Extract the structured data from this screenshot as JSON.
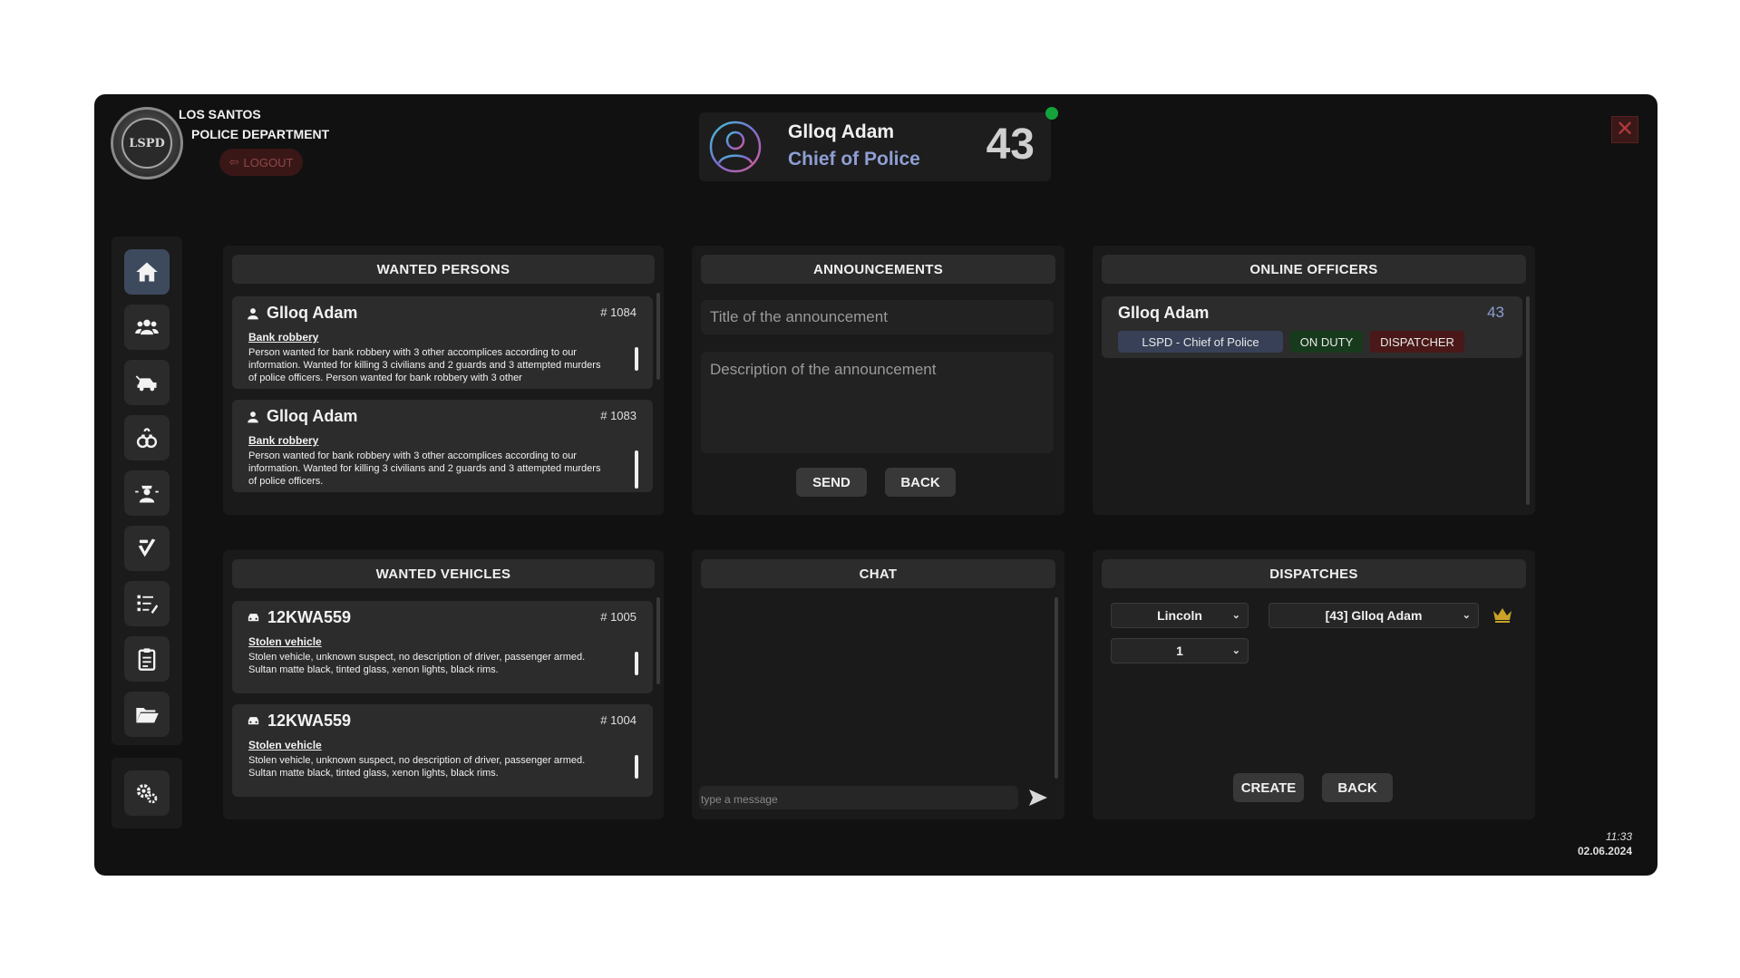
{
  "header": {
    "badge_text": "LSPD",
    "dept_line1": "LOS SANTOS",
    "dept_line2": "POLICE DEPARTMENT",
    "logout_label": "LOGOUT",
    "officer_name": "Glloq Adam",
    "officer_rank": "Chief of Police",
    "badge_number": "43",
    "close_label": "✕"
  },
  "sidebar": {
    "items": [
      {
        "icon": "home-icon",
        "active": true
      },
      {
        "icon": "persons-icon",
        "active": false
      },
      {
        "icon": "vehicle-icon",
        "active": false
      },
      {
        "icon": "handcuffs-icon",
        "active": false
      },
      {
        "icon": "officer-icon",
        "active": false
      },
      {
        "icon": "evidence-icon",
        "active": false
      },
      {
        "icon": "reports-icon",
        "active": false
      },
      {
        "icon": "clipboard-icon",
        "active": false
      },
      {
        "icon": "folder-icon",
        "active": false
      }
    ],
    "settings_icon": "settings-icon"
  },
  "wanted_persons": {
    "title": "WANTED PERSONS",
    "items": [
      {
        "name": "Glloq Adam",
        "id": "# 1084",
        "reason": "Bank robbery",
        "description": "Person wanted for bank robbery with 3 other accomplices according to our information. Wanted for killing 3 civilians and 2 guards and 3 attempted murders of police officers. Person wanted for bank robbery with 3 other"
      },
      {
        "name": "Glloq Adam",
        "id": "# 1083",
        "reason": "Bank robbery",
        "description": "Person wanted for bank robbery with 3 other accomplices according to our information. Wanted for killing 3 civilians and 2 guards and 3 attempted murders of police officers."
      }
    ]
  },
  "announcements": {
    "title": "ANNOUNCEMENTS",
    "title_placeholder": "Title of the announcement",
    "description_placeholder": "Description of the announcement",
    "send_label": "SEND",
    "back_label": "BACK"
  },
  "online_officers": {
    "title": "ONLINE OFFICERS",
    "officers": [
      {
        "name": "Glloq Adam",
        "badge": "43",
        "unit": "LSPD - Chief of Police",
        "status": "ON DUTY",
        "role": "DISPATCHER"
      }
    ]
  },
  "wanted_vehicles": {
    "title": "WANTED VEHICLES",
    "items": [
      {
        "plate": "12KWA559",
        "id": "# 1005",
        "reason": "Stolen vehicle",
        "description": "Stolen vehicle, unknown suspect, no description of driver, passenger armed. Sultan matte black, tinted glass, xenon lights, black rims."
      },
      {
        "plate": "12KWA559",
        "id": "# 1004",
        "reason": "Stolen vehicle",
        "description": "Stolen vehicle, unknown suspect, no description of driver, passenger armed. Sultan matte black, tinted glass, xenon lights, black rims."
      }
    ]
  },
  "chat": {
    "title": "CHAT",
    "input_placeholder": "type a message"
  },
  "dispatches": {
    "title": "DISPATCHES",
    "unit_select": "Lincoln",
    "officer_select": "[43] Glloq Adam",
    "count_select": "1",
    "create_label": "CREATE",
    "back_label": "BACK"
  },
  "clock": {
    "time": "11:33",
    "date": "02.06.2024"
  },
  "colors": {
    "accent_rank": "#8f9ed3",
    "online": "#14a33a",
    "crown": "#c9a227"
  }
}
